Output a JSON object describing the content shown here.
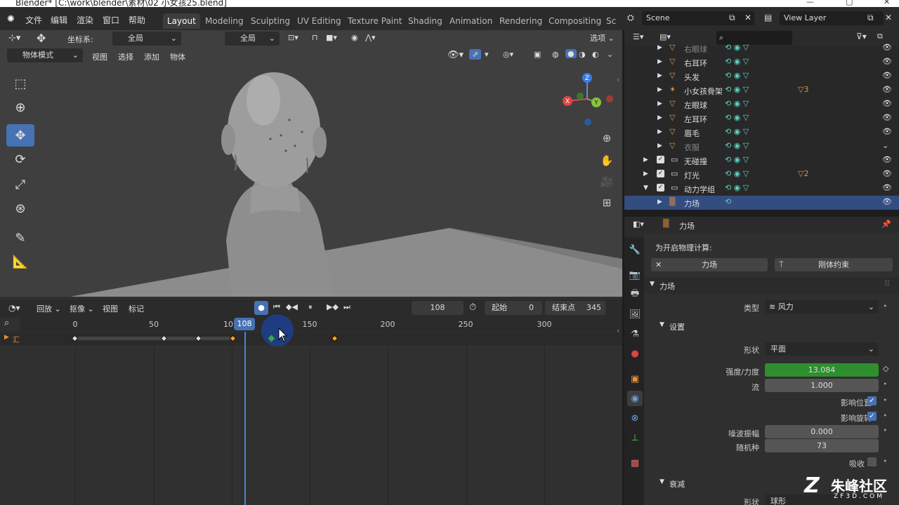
{
  "window": {
    "title": "Blender* [C:\\work\\blender\\素材\\02 小女孩25.blend]"
  },
  "menus": [
    "文件",
    "编辑",
    "渲染",
    "窗口",
    "帮助"
  ],
  "workspaces": [
    "Layout",
    "Modeling",
    "Sculpting",
    "UV Editing",
    "Texture Paint",
    "Shading",
    "Animation",
    "Rendering",
    "Compositing",
    "Sc"
  ],
  "scene": {
    "name": "Scene",
    "view_layer": "View Layer"
  },
  "viewport": {
    "transform_label": "坐标系:",
    "transform_value": "全局",
    "pivot_value": "全局",
    "options_label": "选项",
    "mode": "物体模式",
    "header_menus": [
      "视图",
      "选择",
      "添加",
      "物体"
    ],
    "gizmo": {
      "x": "X",
      "y": "Y",
      "z": "Z"
    }
  },
  "timeline": {
    "menus": [
      "回放",
      "抠像",
      "视图",
      "标记"
    ],
    "current_frame": "108",
    "start_label": "起始",
    "start": "0",
    "end_label": "结束点",
    "end": "345",
    "ruler": [
      "0",
      "50",
      "10",
      "150",
      "200",
      "250",
      "300"
    ],
    "summary_label": "汇",
    "keyframes": [
      0,
      57,
      79,
      101,
      125,
      166
    ]
  },
  "outliner": {
    "rows": [
      {
        "name": "右眼球",
        "faded": true
      },
      {
        "name": "右耳环"
      },
      {
        "name": "头发"
      },
      {
        "name": "小女孩骨架",
        "badge": "3"
      },
      {
        "name": "左眼球"
      },
      {
        "name": "左耳环"
      },
      {
        "name": "眉毛"
      },
      {
        "name": "衣服",
        "faded": true
      },
      {
        "name": "无碰撞"
      },
      {
        "name": "灯光",
        "badge": "2"
      },
      {
        "name": "动力学组"
      },
      {
        "name": "力场",
        "selected": true
      }
    ]
  },
  "properties": {
    "object_name": "力场",
    "enable_physics": "为开启物理计算:",
    "btn_forcefield": "力场",
    "btn_rigidbody_constraint": "刚体约束",
    "section_forcefield": "力场",
    "type_label": "类型",
    "type_value": "风力",
    "settings_label": "设置",
    "shape_label": "形状",
    "shape_value": "平面",
    "strength_label": "强度/力度",
    "strength_value": "13.084",
    "flow_label": "流",
    "flow_value": "1.000",
    "affect_location": "影响位置",
    "affect_rotation": "影响旋转",
    "noise_label": "噪波振幅",
    "noise_value": "0.000",
    "seed_label": "随机种",
    "seed_value": "73",
    "absorb_label": "吸收",
    "falloff_label": "衰减",
    "falloff_shape_label": "形状",
    "falloff_shape_value": "球形"
  },
  "watermark": {
    "text": "朱峰社区",
    "sub": "ZF3D.COM"
  },
  "colors": {
    "accent": "#4772b3",
    "keyframe_selected": "#f5a623",
    "strength_bar": "#2f8f2f",
    "object_icon": "#e8913a"
  }
}
